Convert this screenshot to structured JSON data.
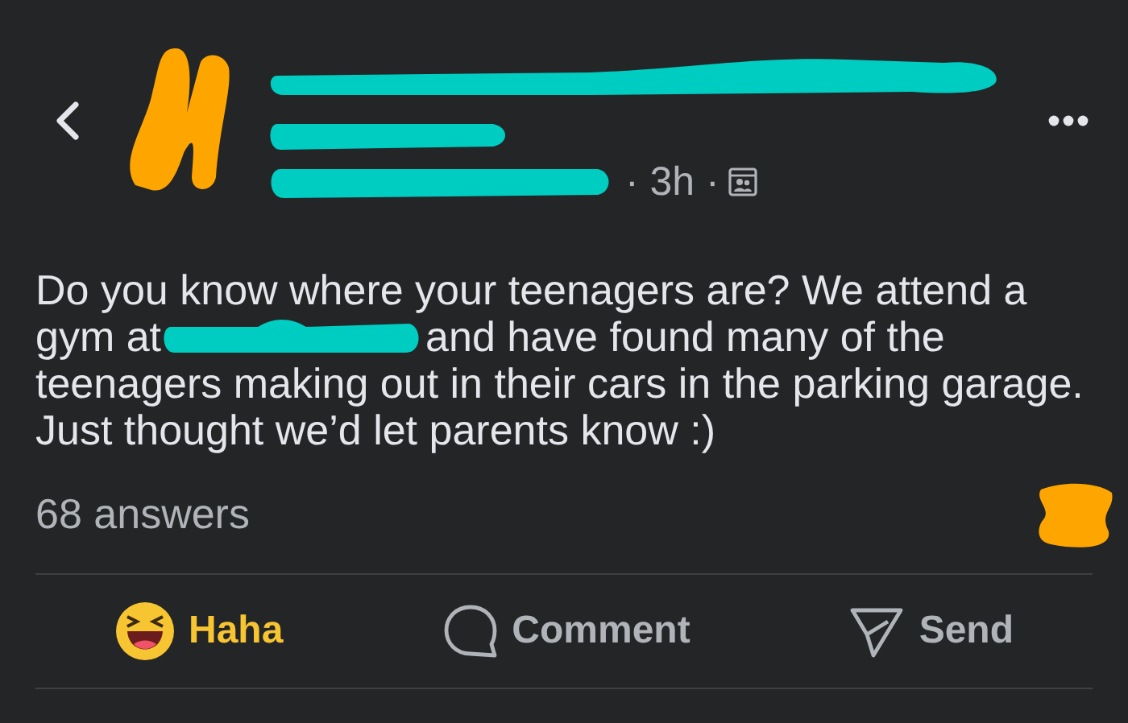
{
  "header": {
    "time": "· 3h ·"
  },
  "post": {
    "line_1": "Do you know where your teenagers are? We attend a",
    "before_mark": "gym at",
    "after_mark": "and have found many of the",
    "rest": "teenagers making out in their cars in the parking garage. Just thought we’d let parents know :)"
  },
  "answers": "68 answers",
  "actions": [
    {
      "kind": "reaction",
      "label": "Haha",
      "selected": true
    },
    {
      "kind": "comment",
      "label": "Comment",
      "selected": false
    },
    {
      "kind": "send",
      "label": "Send",
      "selected": false
    }
  ]
}
